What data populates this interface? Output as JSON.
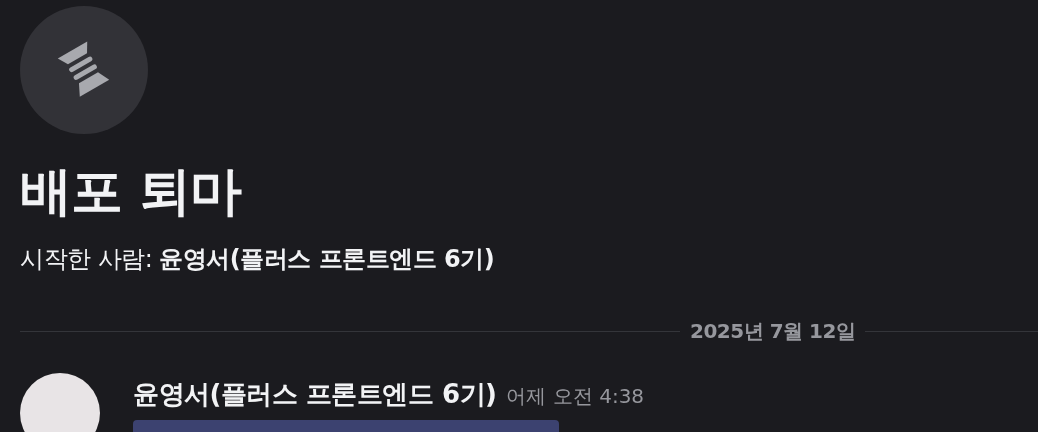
{
  "thread": {
    "title": "배포 퇴마",
    "starter_label": "시작한 사람:",
    "starter_name": "윤영서(플러스 프론트엔드 6기)"
  },
  "date_divider": "2025년 7월 12일",
  "messages": [
    {
      "author": "윤영서(플러스 프론트엔드 6기)",
      "timestamp": "어제 오전 4:38",
      "has_mention": true
    }
  ]
}
